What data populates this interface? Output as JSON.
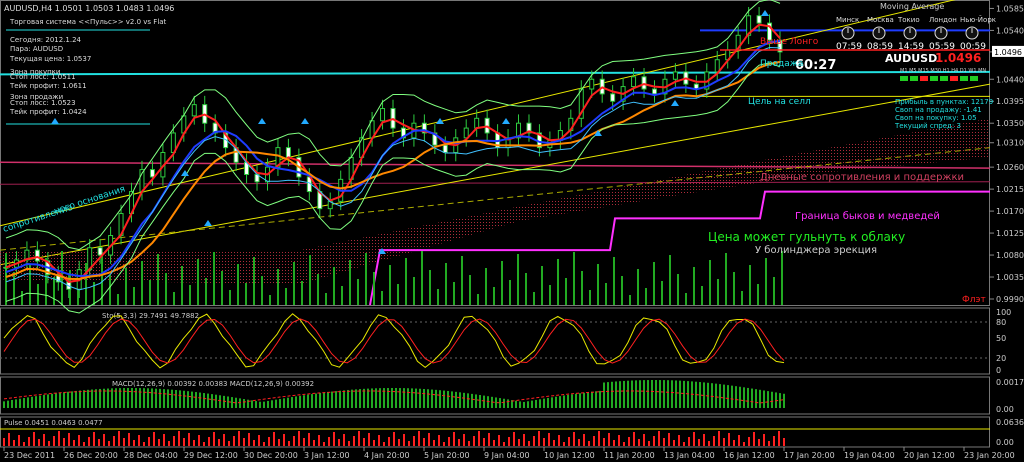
{
  "chart_data": {
    "type": "line",
    "symbol_header": "AUDUSD,H4  1.0501 1.0503 1.0483 1.0496",
    "indicator_label": "Moving Average",
    "info_panel": [
      "Торговая система <<Пульс>> v2.0 vs Flat",
      "Сегодня:  2012.1.24",
      "Пара:  AUDUSD",
      "Текущая цена:  1.0537",
      "Зона покупки",
      "Стоп лосс:  1.0511",
      "Тейк профит:  1.0611",
      "Зона продажи",
      "Стоп лосс:  1.0523",
      "Тейк профит:  1.0424"
    ],
    "price_axis": [
      "1.0585",
      "1.0540",
      "1.0496",
      "1.0440",
      "1.0395",
      "1.0350",
      "1.0310",
      "1.0260",
      "1.0215",
      "1.0170",
      "1.0125",
      "1.0080",
      "1.0035",
      "0.9990"
    ],
    "current_price_label": "1.0496",
    "time_axis": [
      "23 Dec 2011",
      "26 Dec 20:00",
      "28 Dec 04:00",
      "29 Dec 12:00",
      "30 Dec 20:00",
      "3 Jan 12:00",
      "4 Jan 20:00",
      "5 Jan 20:00",
      "9 Jan 04:00",
      "10 Jan 12:00",
      "11 Jan 20:00",
      "13 Jan 04:00",
      "16 Jan 12:00",
      "17 Jan 20:00",
      "19 Jan 04:00",
      "20 Jan 12:00",
      "23 Jan 20:00"
    ],
    "clocks": [
      {
        "city": "Минск",
        "time": "07:59"
      },
      {
        "city": "Москва",
        "time": "08:59"
      },
      {
        "city": "Токио",
        "time": "14:59"
      },
      {
        "city": "Лондон",
        "time": "05:59"
      },
      {
        "city": "Нью-Йорк",
        "time": "00:59"
      }
    ],
    "bar_timer": "60:27",
    "pair_big": "AUDUSD",
    "pair_price": "1.0496",
    "timeframes": "M1 M5 M15 M30 H1 H4 D1 W1 MN",
    "right_info": [
      "Прибыль в пунктах: 12179",
      "Своп на продажу: -1.41",
      "Своп на покупку: 1.05",
      "Текущий спред: 3"
    ],
    "annotations": {
      "resistance_top": "Выше Лонго",
      "sell": "Продажа",
      "sell_target": "Цель на селл",
      "daily_sr": "Дневные сопротивления и поддержки",
      "bulls_bears": "Граница быков и медведей",
      "cloud_bounce": "Цена может гульнуть к облаку",
      "bollinger": "У болинджера эрекция",
      "flat": "Флэт",
      "left_resist": "сопротивление",
      "left_base": "ного основания",
      "buy_mark": "Покупка"
    },
    "subwindows": [
      {
        "label": "Sto(5,3,3) 29.7491 49.7882",
        "axis": [
          "100",
          "80",
          "50",
          "20",
          "0"
        ]
      },
      {
        "label": "MACD(12,26,9) 0.00392 0.00383  MACD(12,26,9) 0.00392",
        "axis": [
          "0.00174",
          "0.00"
        ]
      },
      {
        "label": "Pulse 0.0451 0.0463 0.0477",
        "axis": [
          "0.0636",
          "0.00"
        ]
      }
    ],
    "close_series": [
      1.0055,
      1.007,
      1.009,
      1.0068,
      1.004,
      1.0025,
      1.001,
      1.005,
      1.0095,
      1.008,
      1.012,
      1.0165,
      1.021,
      1.0255,
      1.024,
      1.029,
      1.033,
      1.0365,
      1.0388,
      1.035,
      1.033,
      1.03,
      1.027,
      1.0245,
      1.023,
      1.026,
      1.03,
      1.028,
      1.024,
      1.021,
      1.0175,
      1.019,
      1.0235,
      1.028,
      1.032,
      1.0355,
      1.038,
      1.034,
      1.032,
      1.035,
      1.033,
      1.0305,
      1.029,
      1.032,
      1.034,
      1.036,
      1.033,
      1.03,
      1.032,
      1.035,
      1.033,
      1.03,
      1.0315,
      1.0335,
      1.036,
      1.042,
      1.044,
      1.041,
      1.0395,
      1.0425,
      1.0445,
      1.042,
      1.041,
      1.044,
      1.0455,
      1.043,
      1.042,
      1.0455,
      1.048,
      1.05,
      1.053,
      1.057,
      1.0555,
      1.052,
      1.0496
    ],
    "ylim": [
      0.999,
      1.059
    ]
  }
}
